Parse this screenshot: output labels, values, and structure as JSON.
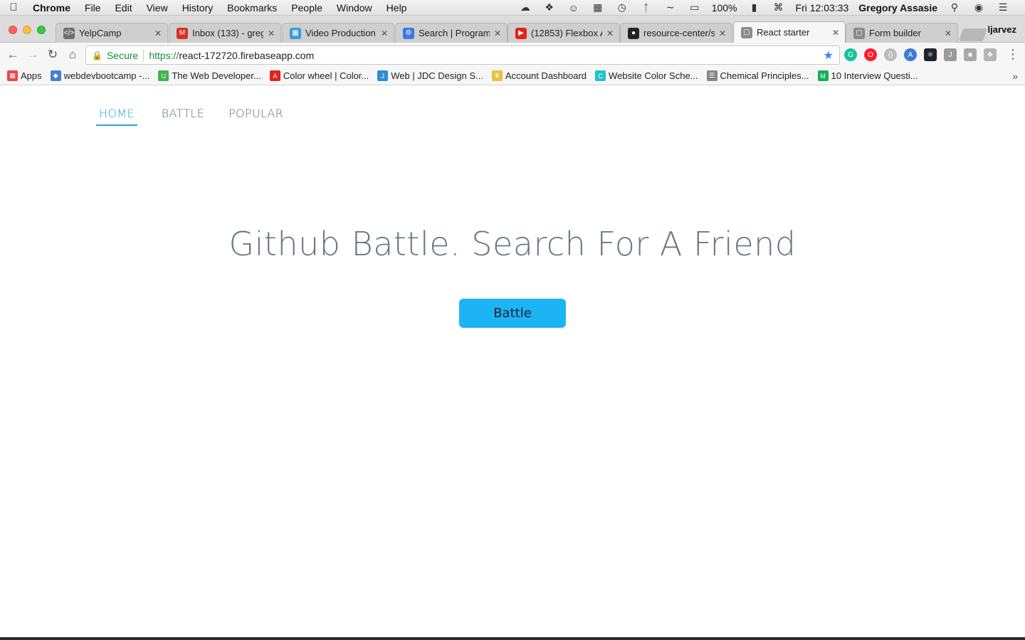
{
  "menubar": {
    "app_name": "Chrome",
    "menus": [
      "File",
      "Edit",
      "View",
      "History",
      "Bookmarks",
      "People",
      "Window",
      "Help"
    ],
    "battery": "100%",
    "clock": "Fri 12:03:33",
    "user": "Gregory Assasie"
  },
  "tabs": [
    {
      "title": "YelpCamp",
      "favicon": "code-icon",
      "color": "#6f6f6f"
    },
    {
      "title": "Inbox (133) - greg",
      "favicon": "gmail-icon",
      "color": "#d93025"
    },
    {
      "title": "Video Production |",
      "favicon": "slides-icon",
      "color": "#3f9ad6"
    },
    {
      "title": "Search | Programm",
      "favicon": "gear-icon",
      "color": "#3b78e7"
    },
    {
      "title": "(12853) Flexbox A",
      "favicon": "youtube-icon",
      "color": "#e62117"
    },
    {
      "title": "resource-center/s",
      "favicon": "github-icon",
      "color": "#222222"
    },
    {
      "title": "React starter",
      "favicon": "page-icon",
      "color": "#8a8a8a",
      "active": true
    },
    {
      "title": "Form builder",
      "favicon": "page-icon",
      "color": "#8a8a8a"
    }
  ],
  "profile_name": "ljarvez",
  "omnibox": {
    "secure_label": "Secure",
    "scheme": "https://",
    "host": "react-172720.firebaseapp.com"
  },
  "bookmarks": [
    {
      "label": "Apps",
      "icon": "apps-grid-icon",
      "color": "#e44"
    },
    {
      "label": "webdevbootcamp -...",
      "icon": "bookmark-icon",
      "color": "#4a7fd0"
    },
    {
      "label": "The Web Developer...",
      "icon": "udemy-icon",
      "color": "#3fb34f"
    },
    {
      "label": "Color wheel | Color...",
      "icon": "adobe-icon",
      "color": "#e1251b"
    },
    {
      "label": "Web | JDC Design S...",
      "icon": "jdc-icon",
      "color": "#2a8fd6"
    },
    {
      "label": "Account Dashboard",
      "icon": "crown-icon",
      "color": "#e8c33a"
    },
    {
      "label": "Website Color Sche...",
      "icon": "canva-icon",
      "color": "#20c3c9"
    },
    {
      "label": "Chemical Principles...",
      "icon": "book-icon",
      "color": "#888888"
    },
    {
      "label": "10 Interview Questi...",
      "icon": "medium-icon",
      "color": "#12b05a"
    }
  ],
  "page": {
    "nav": [
      {
        "label": "HOME",
        "active": true
      },
      {
        "label": "BATTLE",
        "active": false
      },
      {
        "label": "POPULAR",
        "active": false
      }
    ],
    "title": "Github Battle. Search For A Friend",
    "cta_label": "Battle"
  },
  "colors": {
    "accent": "#2aa3e0",
    "button": "#1db4f5",
    "title_text": "#6b7784"
  }
}
